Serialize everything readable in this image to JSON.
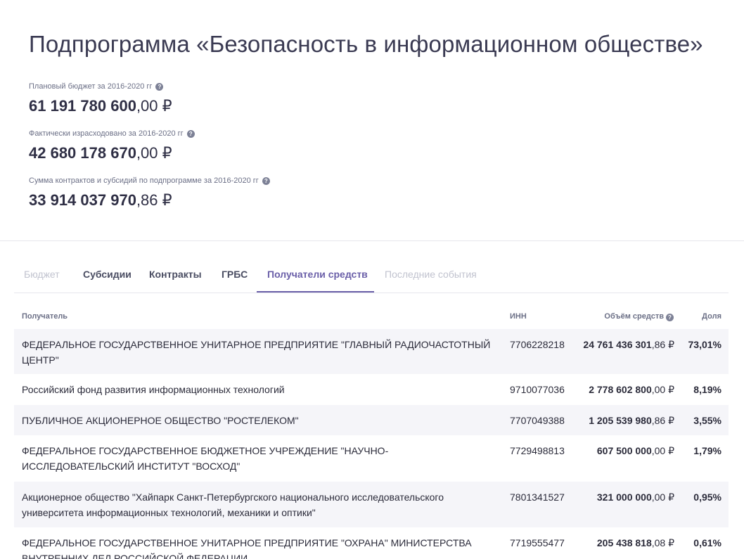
{
  "page": {
    "title": "Подпрограмма «Безопасность в информационном обществе»"
  },
  "stats": [
    {
      "label": "Плановый бюджет за 2016-2020 гг",
      "value_int": "61 191 780 600",
      "value_frac": ",00 ₽"
    },
    {
      "label": "Фактически израсходовано за 2016-2020 гг",
      "value_int": "42 680 178 670",
      "value_frac": ",00 ₽"
    },
    {
      "label": "Сумма контрактов и субсидий по подпрограмме за 2016-2020 гг",
      "value_int": "33 914 037 970",
      "value_frac": ",86 ₽"
    }
  ],
  "help_glyph": "?",
  "tabs": [
    {
      "label": "Бюджет",
      "state": "disabled"
    },
    {
      "label": "Субсидии",
      "state": "normal"
    },
    {
      "label": "Контракты",
      "state": "normal"
    },
    {
      "label": "ГРБС",
      "state": "normal"
    },
    {
      "label": "Получатели средств",
      "state": "active"
    },
    {
      "label": "Последние события",
      "state": "disabled"
    }
  ],
  "table": {
    "headers": {
      "recipient": "Получатель",
      "inn": "ИНН",
      "amount": "Объём средств",
      "share": "Доля"
    },
    "rows": [
      {
        "name": "ФЕДЕРАЛЬНОЕ ГОСУДАРСТВЕННОЕ УНИТАРНОЕ ПРЕДПРИЯТИЕ \"ГЛАВНЫЙ РАДИОЧАСТОТНЫЙ ЦЕНТР\"",
        "inn": "7706228218",
        "amount_int": "24 761 436 301",
        "amount_frac": ",86 ₽",
        "share": "73,01%"
      },
      {
        "name": "Российский фонд развития информационных технологий",
        "inn": "9710077036",
        "amount_int": "2 778 602 800",
        "amount_frac": ",00 ₽",
        "share": "8,19%"
      },
      {
        "name": "ПУБЛИЧНОЕ АКЦИОНЕРНОЕ ОБЩЕСТВО \"РОСТЕЛЕКОМ\"",
        "inn": "7707049388",
        "amount_int": "1 205 539 980",
        "amount_frac": ",86 ₽",
        "share": "3,55%"
      },
      {
        "name": "ФЕДЕРАЛЬНОЕ ГОСУДАРСТВЕННОЕ БЮДЖЕТНОЕ УЧРЕЖДЕНИЕ \"НАУЧНО-ИССЛЕДОВАТЕЛЬСКИЙ ИНСТИТУТ \"ВОСХОД\"",
        "inn": "7729498813",
        "amount_int": "607 500 000",
        "amount_frac": ",00 ₽",
        "share": "1,79%"
      },
      {
        "name": "Акционерное общество \"Хайпарк Санкт-Петербургского национального исследовательского университета информационных технологий, механики и оптики\"",
        "inn": "7801341527",
        "amount_int": "321 000 000",
        "amount_frac": ",00 ₽",
        "share": "0,95%"
      },
      {
        "name": "ФЕДЕРАЛЬНОЕ ГОСУДАРСТВЕННОЕ УНИТАРНОЕ ПРЕДПРИЯТИЕ \"ОХРАНА\" МИНИСТЕРСТВА ВНУТРЕННИХ ДЕЛ РОССИЙСКОЙ ФЕДЕРАЦИИ",
        "inn": "7719555477",
        "amount_int": "205 438 818",
        "amount_frac": ",08 ₽",
        "share": "0,61%"
      }
    ]
  },
  "colors": {
    "accent": "#6a5fa8",
    "row_shade": "#f5f5f9",
    "muted_text": "#6b6f86",
    "disabled_tab": "#c1c3cf"
  }
}
